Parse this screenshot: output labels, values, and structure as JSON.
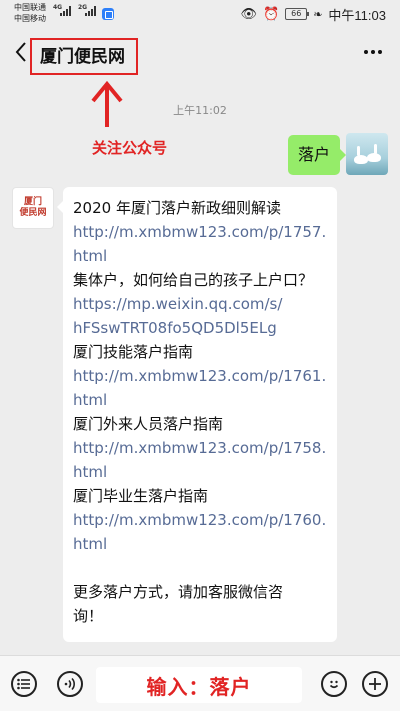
{
  "status_bar": {
    "carrier_1": "中国联通",
    "carrier_2": "中国移动",
    "network_1": "4G",
    "network_2": "2G",
    "battery": "66",
    "time": "中午11:03"
  },
  "header": {
    "title": "厦门便民网"
  },
  "annotation": {
    "follow_note": "关注公众号"
  },
  "chat": {
    "timestamp": "上午11:02",
    "sent_message": "落户",
    "official_avatar": [
      "厦门",
      "便民网"
    ],
    "received_lines": [
      {
        "text": "2020 年厦门落户新政细则解读",
        "link": false
      },
      {
        "text": "http://m.xmbmw123.com/p/1757.",
        "link": true
      },
      {
        "text": "html",
        "link": true
      },
      {
        "text": "集体户，如何给自己的孩子上户口？",
        "link": false
      },
      {
        "text": "https://mp.weixin.qq.com/s/",
        "link": true
      },
      {
        "text": "hFSswTRT08fo5QD5Dl5ELg",
        "link": true
      },
      {
        "text": "厦门技能落户指南",
        "link": false
      },
      {
        "text": "http://m.xmbmw123.com/p/1761.",
        "link": true
      },
      {
        "text": "html",
        "link": true
      },
      {
        "text": "厦门外来人员落户指南",
        "link": false
      },
      {
        "text": "http://m.xmbmw123.com/p/1758.",
        "link": true
      },
      {
        "text": "html",
        "link": true
      },
      {
        "text": "厦门毕业生落户指南",
        "link": false
      },
      {
        "text": "http://m.xmbmw123.com/p/1760.",
        "link": true
      },
      {
        "text": "html",
        "link": true
      },
      {
        "text": "",
        "link": false
      },
      {
        "text": "更多落户方式，请加客服微信咨",
        "link": false
      },
      {
        "text": "询！",
        "link": false
      }
    ]
  },
  "input_bar": {
    "prompt": "输入：落户",
    "icons": [
      "menu-list-icon",
      "voice-icon",
      "emoji-icon",
      "plus-icon"
    ]
  },
  "colors": {
    "sent_bubble": "#95ec69",
    "link": "#576b95",
    "annotation_red": "#e12424"
  }
}
